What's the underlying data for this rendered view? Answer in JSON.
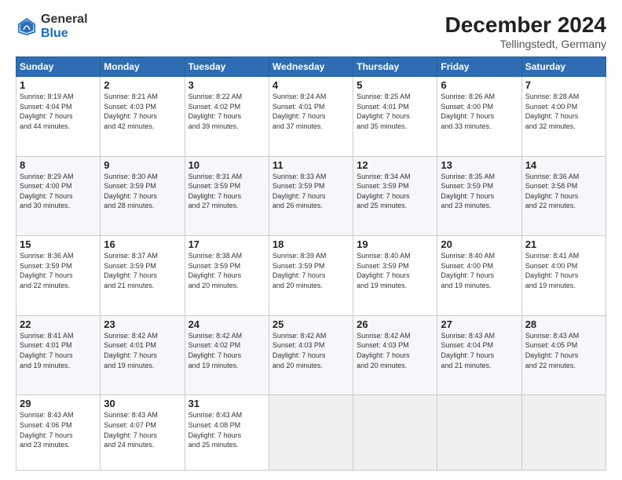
{
  "logo": {
    "general": "General",
    "blue": "Blue"
  },
  "header": {
    "title": "December 2024",
    "subtitle": "Tellingstedt, Germany"
  },
  "weekdays": [
    "Sunday",
    "Monday",
    "Tuesday",
    "Wednesday",
    "Thursday",
    "Friday",
    "Saturday"
  ],
  "weeks": [
    [
      {
        "day": "1",
        "lines": [
          "Sunrise: 8:19 AM",
          "Sunset: 4:04 PM",
          "Daylight: 7 hours",
          "and 44 minutes."
        ]
      },
      {
        "day": "2",
        "lines": [
          "Sunrise: 8:21 AM",
          "Sunset: 4:03 PM",
          "Daylight: 7 hours",
          "and 42 minutes."
        ]
      },
      {
        "day": "3",
        "lines": [
          "Sunrise: 8:22 AM",
          "Sunset: 4:02 PM",
          "Daylight: 7 hours",
          "and 39 minutes."
        ]
      },
      {
        "day": "4",
        "lines": [
          "Sunrise: 8:24 AM",
          "Sunset: 4:01 PM",
          "Daylight: 7 hours",
          "and 37 minutes."
        ]
      },
      {
        "day": "5",
        "lines": [
          "Sunrise: 8:25 AM",
          "Sunset: 4:01 PM",
          "Daylight: 7 hours",
          "and 35 minutes."
        ]
      },
      {
        "day": "6",
        "lines": [
          "Sunrise: 8:26 AM",
          "Sunset: 4:00 PM",
          "Daylight: 7 hours",
          "and 33 minutes."
        ]
      },
      {
        "day": "7",
        "lines": [
          "Sunrise: 8:28 AM",
          "Sunset: 4:00 PM",
          "Daylight: 7 hours",
          "and 32 minutes."
        ]
      }
    ],
    [
      {
        "day": "8",
        "lines": [
          "Sunrise: 8:29 AM",
          "Sunset: 4:00 PM",
          "Daylight: 7 hours",
          "and 30 minutes."
        ]
      },
      {
        "day": "9",
        "lines": [
          "Sunrise: 8:30 AM",
          "Sunset: 3:59 PM",
          "Daylight: 7 hours",
          "and 28 minutes."
        ]
      },
      {
        "day": "10",
        "lines": [
          "Sunrise: 8:31 AM",
          "Sunset: 3:59 PM",
          "Daylight: 7 hours",
          "and 27 minutes."
        ]
      },
      {
        "day": "11",
        "lines": [
          "Sunrise: 8:33 AM",
          "Sunset: 3:59 PM",
          "Daylight: 7 hours",
          "and 26 minutes."
        ]
      },
      {
        "day": "12",
        "lines": [
          "Sunrise: 8:34 AM",
          "Sunset: 3:59 PM",
          "Daylight: 7 hours",
          "and 25 minutes."
        ]
      },
      {
        "day": "13",
        "lines": [
          "Sunrise: 8:35 AM",
          "Sunset: 3:59 PM",
          "Daylight: 7 hours",
          "and 23 minutes."
        ]
      },
      {
        "day": "14",
        "lines": [
          "Sunrise: 8:36 AM",
          "Sunset: 3:58 PM",
          "Daylight: 7 hours",
          "and 22 minutes."
        ]
      }
    ],
    [
      {
        "day": "15",
        "lines": [
          "Sunrise: 8:36 AM",
          "Sunset: 3:59 PM",
          "Daylight: 7 hours",
          "and 22 minutes."
        ]
      },
      {
        "day": "16",
        "lines": [
          "Sunrise: 8:37 AM",
          "Sunset: 3:59 PM",
          "Daylight: 7 hours",
          "and 21 minutes."
        ]
      },
      {
        "day": "17",
        "lines": [
          "Sunrise: 8:38 AM",
          "Sunset: 3:59 PM",
          "Daylight: 7 hours",
          "and 20 minutes."
        ]
      },
      {
        "day": "18",
        "lines": [
          "Sunrise: 8:39 AM",
          "Sunset: 3:59 PM",
          "Daylight: 7 hours",
          "and 20 minutes."
        ]
      },
      {
        "day": "19",
        "lines": [
          "Sunrise: 8:40 AM",
          "Sunset: 3:59 PM",
          "Daylight: 7 hours",
          "and 19 minutes."
        ]
      },
      {
        "day": "20",
        "lines": [
          "Sunrise: 8:40 AM",
          "Sunset: 4:00 PM",
          "Daylight: 7 hours",
          "and 19 minutes."
        ]
      },
      {
        "day": "21",
        "lines": [
          "Sunrise: 8:41 AM",
          "Sunset: 4:00 PM",
          "Daylight: 7 hours",
          "and 19 minutes."
        ]
      }
    ],
    [
      {
        "day": "22",
        "lines": [
          "Sunrise: 8:41 AM",
          "Sunset: 4:01 PM",
          "Daylight: 7 hours",
          "and 19 minutes."
        ]
      },
      {
        "day": "23",
        "lines": [
          "Sunrise: 8:42 AM",
          "Sunset: 4:01 PM",
          "Daylight: 7 hours",
          "and 19 minutes."
        ]
      },
      {
        "day": "24",
        "lines": [
          "Sunrise: 8:42 AM",
          "Sunset: 4:02 PM",
          "Daylight: 7 hours",
          "and 19 minutes."
        ]
      },
      {
        "day": "25",
        "lines": [
          "Sunrise: 8:42 AM",
          "Sunset: 4:03 PM",
          "Daylight: 7 hours",
          "and 20 minutes."
        ]
      },
      {
        "day": "26",
        "lines": [
          "Sunrise: 8:42 AM",
          "Sunset: 4:03 PM",
          "Daylight: 7 hours",
          "and 20 minutes."
        ]
      },
      {
        "day": "27",
        "lines": [
          "Sunrise: 8:43 AM",
          "Sunset: 4:04 PM",
          "Daylight: 7 hours",
          "and 21 minutes."
        ]
      },
      {
        "day": "28",
        "lines": [
          "Sunrise: 8:43 AM",
          "Sunset: 4:05 PM",
          "Daylight: 7 hours",
          "and 22 minutes."
        ]
      }
    ],
    [
      {
        "day": "29",
        "lines": [
          "Sunrise: 8:43 AM",
          "Sunset: 4:06 PM",
          "Daylight: 7 hours",
          "and 23 minutes."
        ]
      },
      {
        "day": "30",
        "lines": [
          "Sunrise: 8:43 AM",
          "Sunset: 4:07 PM",
          "Daylight: 7 hours",
          "and 24 minutes."
        ]
      },
      {
        "day": "31",
        "lines": [
          "Sunrise: 8:43 AM",
          "Sunset: 4:08 PM",
          "Daylight: 7 hours",
          "and 25 minutes."
        ]
      },
      null,
      null,
      null,
      null
    ]
  ]
}
